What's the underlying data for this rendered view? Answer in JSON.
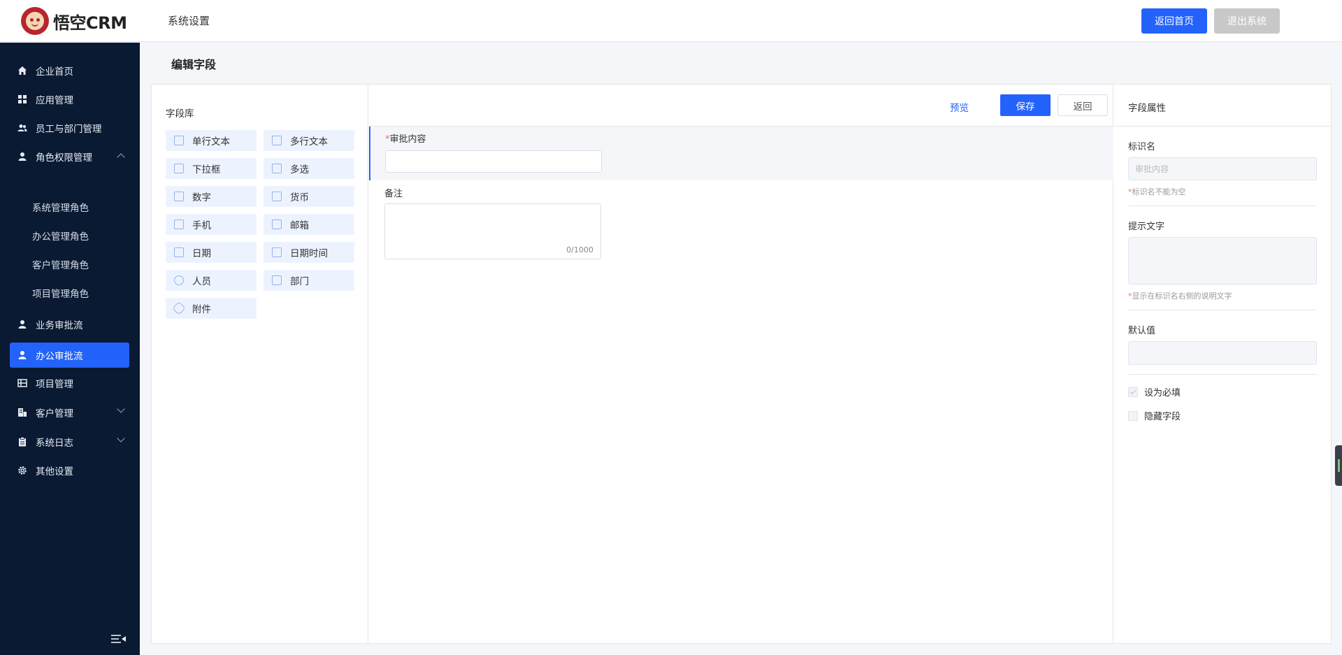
{
  "header": {
    "logo_text": "悟空CRM",
    "title": "系统设置",
    "home_button": "返回首页",
    "logout_button": "退出系统"
  },
  "sidebar": {
    "items": [
      {
        "label": "企业首页",
        "icon": "home-icon"
      },
      {
        "label": "应用管理",
        "icon": "grid-icon"
      },
      {
        "label": "员工与部门管理",
        "icon": "users-icon"
      },
      {
        "label": "角色权限管理",
        "icon": "user-icon",
        "expanded": true
      },
      {
        "label": "业务审批流",
        "icon": "user-icon"
      },
      {
        "label": "办公审批流",
        "icon": "user-icon",
        "active": true
      },
      {
        "label": "项目管理",
        "icon": "board-icon"
      },
      {
        "label": "客户管理",
        "icon": "building-icon"
      },
      {
        "label": "系统日志",
        "icon": "clipboard-icon"
      },
      {
        "label": "其他设置",
        "icon": "gear-icon"
      }
    ],
    "sub_items": [
      "系统管理角色",
      "办公管理角色",
      "客户管理角色",
      "项目管理角色"
    ]
  },
  "page": {
    "title": "编辑字段"
  },
  "field_library": {
    "title": "字段库",
    "fields": [
      "单行文本",
      "多行文本",
      "下拉框",
      "多选",
      "数字",
      "货币",
      "手机",
      "邮箱",
      "日期",
      "日期时间",
      "人员",
      "部门",
      "附件"
    ]
  },
  "toolbar": {
    "preview": "预览",
    "save": "保存",
    "back": "返回"
  },
  "form": {
    "field1_required_mark": "*",
    "field1_label": "审批内容",
    "field2_label": "备注",
    "field2_counter": "0/1000"
  },
  "properties": {
    "title": "字段属性",
    "name_label": "标识名",
    "name_value": "审批内容",
    "name_hint_mark": "*",
    "name_hint": "标识名不能为空",
    "tip_label": "提示文字",
    "tip_hint_mark": "*",
    "tip_hint": "显示在标识名右侧的说明文字",
    "default_label": "默认值",
    "required_label": "设为必填",
    "required_checked": true,
    "hidden_label": "隐藏字段",
    "hidden_checked": false
  },
  "colors": {
    "primary": "#2362fb",
    "sidebar": "#0a1a33",
    "chip": "#edf3fe"
  }
}
